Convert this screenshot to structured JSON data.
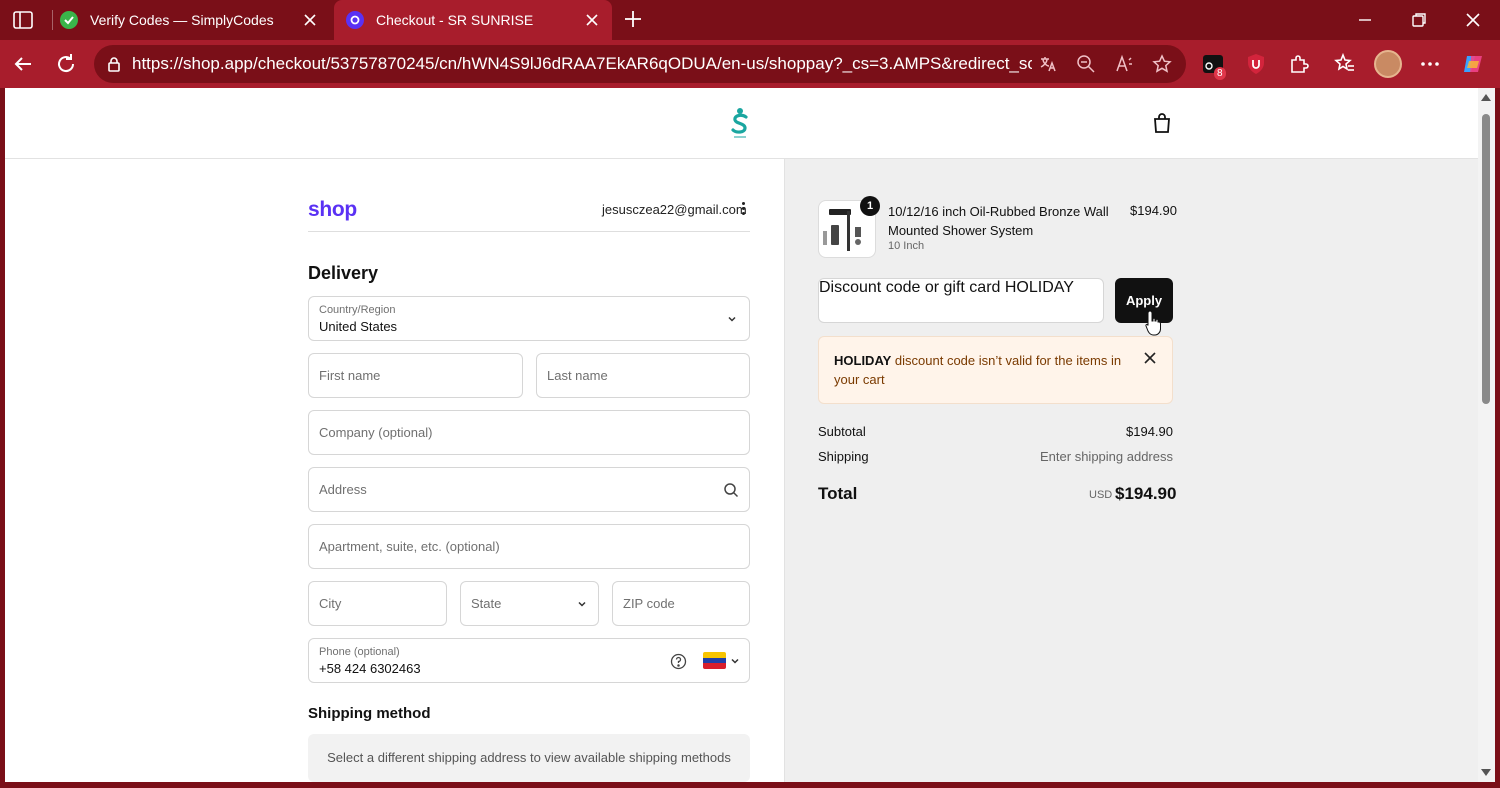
{
  "browser": {
    "tabs": [
      {
        "title": "Verify Codes — SimplyCodes",
        "active": false
      },
      {
        "title": "Checkout - SR SUNRISE",
        "active": true
      }
    ],
    "url": "https://shop.app/checkout/53757870245/cn/hWN4S9lJ6dRAA7EkAR6qODUA/en-us/shoppay?_cs=3.AMPS&redirect_sourc...",
    "extension_badge": "8",
    "colors": {
      "frame": "#7a0f18",
      "toolbar": "#a81d2c"
    }
  },
  "checkout": {
    "shop_logo": "shop",
    "account_email": "jesusczea22@gmail.com",
    "delivery_title": "Delivery",
    "country": {
      "label": "Country/Region",
      "value": "United States"
    },
    "first_name_placeholder": "First name",
    "last_name_placeholder": "Last name",
    "company_placeholder": "Company (optional)",
    "address_placeholder": "Address",
    "apartment_placeholder": "Apartment, suite, etc. (optional)",
    "city_placeholder": "City",
    "state_placeholder": "State",
    "zip_placeholder": "ZIP code",
    "phone": {
      "label": "Phone (optional)",
      "value": "+58 424 6302463"
    },
    "shipping_method_title": "Shipping method",
    "shipping_method_note": "Select a different shipping address to view available shipping methods"
  },
  "order": {
    "item": {
      "quantity": "1",
      "name": "10/12/16 inch Oil-Rubbed Bronze Wall Mounted Shower System",
      "variant": "10 Inch",
      "price": "$194.90"
    },
    "discount": {
      "label": "Discount code or gift card",
      "value": "HOLIDAY",
      "apply_label": "Apply"
    },
    "alert": {
      "code": "HOLIDAY",
      "message": " discount code isn’t valid for the items in your cart"
    },
    "subtotal_label": "Subtotal",
    "subtotal_value": "$194.90",
    "shipping_label": "Shipping",
    "shipping_value": "Enter shipping address",
    "total_label": "Total",
    "currency": "USD",
    "total_value": "$194.90"
  },
  "icons": [
    "sidebar-icon",
    "close-icon",
    "plus-icon",
    "minimize-icon",
    "restore-icon",
    "back-icon",
    "refresh-icon",
    "lock-icon",
    "translate-icon",
    "zoom-icon",
    "read-aloud-icon",
    "star-icon",
    "extension-icon",
    "shield-icon",
    "puzzle-icon",
    "favorites-icon",
    "more-icon",
    "copilot-icon",
    "cart-icon",
    "chevron-down-icon",
    "search-icon",
    "help-icon",
    "flag-icon"
  ]
}
